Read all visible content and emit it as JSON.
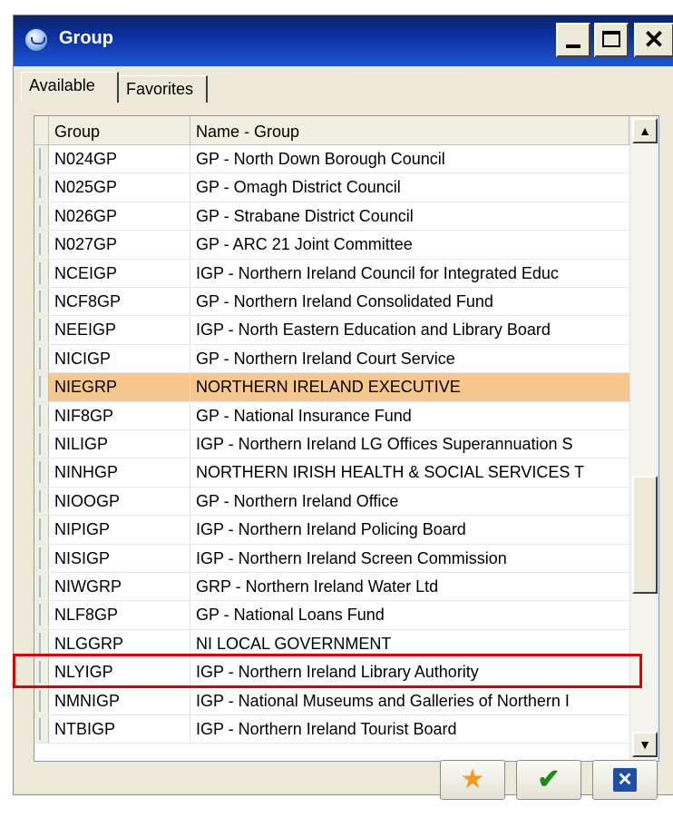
{
  "window": {
    "title": "Group"
  },
  "tabs": [
    {
      "label": "Available",
      "active": true
    },
    {
      "label": "Favorites",
      "active": false
    }
  ],
  "grid": {
    "columns": [
      "Group",
      "Name - Group"
    ],
    "rows": [
      {
        "group": "N024GP",
        "name": "GP - North Down Borough Council"
      },
      {
        "group": "N025GP",
        "name": "GP - Omagh District Council"
      },
      {
        "group": "N026GP",
        "name": "GP - Strabane District Council"
      },
      {
        "group": "N027GP",
        "name": "GP - ARC 21 Joint Committee"
      },
      {
        "group": "NCEIGP",
        "name": "IGP - Northern Ireland Council for Integrated Educ"
      },
      {
        "group": "NCF8GP",
        "name": "GP - Northern Ireland Consolidated Fund"
      },
      {
        "group": "NEEIGP",
        "name": "IGP - North Eastern Education and Library Board"
      },
      {
        "group": "NICIGP",
        "name": "GP - Northern Ireland Court Service"
      },
      {
        "group": "NIEGRP",
        "name": "NORTHERN IRELAND EXECUTIVE",
        "selected": true
      },
      {
        "group": "NIF8GP",
        "name": "GP - National Insurance Fund"
      },
      {
        "group": "NILIGP",
        "name": "IGP - Northern Ireland LG Offices Superannuation S"
      },
      {
        "group": "NINHGP",
        "name": "NORTHERN IRISH HEALTH & SOCIAL SERVICES T"
      },
      {
        "group": "NIOOGP",
        "name": "GP - Northern Ireland Office"
      },
      {
        "group": "NIPIGP",
        "name": "IGP - Northern Ireland Policing Board"
      },
      {
        "group": "NISIGP",
        "name": "IGP - Northern Ireland Screen Commission"
      },
      {
        "group": "NIWGRP",
        "name": "GRP - Northern Ireland Water Ltd"
      },
      {
        "group": "NLF8GP",
        "name": "GP - National Loans Fund"
      },
      {
        "group": "NLGGRP",
        "name": "NI LOCAL GOVERNMENT"
      },
      {
        "group": "NLYIGP",
        "name": "IGP - Northern Ireland Library Authority",
        "annotated": true
      },
      {
        "group": "NMNIGP",
        "name": "IGP - National Museums and Galleries of Northern I"
      },
      {
        "group": "NTBIGP",
        "name": "IGP - Northern Ireland Tourist Board"
      }
    ]
  },
  "scrollbar": {
    "up_glyph": "▲",
    "down_glyph": "▼"
  },
  "buttons": {
    "favorite": {
      "glyph": "★",
      "icon": "star-icon"
    },
    "ok": {
      "glyph": "✔",
      "icon": "check-icon"
    },
    "cancel": {
      "glyph": "✕",
      "icon": "close-icon"
    }
  },
  "window_buttons": {
    "close_glyph": "✕"
  },
  "colors": {
    "selected_row": "#f7c88e",
    "annotation": "#e00000",
    "titlebar": "#0b2fa0"
  }
}
